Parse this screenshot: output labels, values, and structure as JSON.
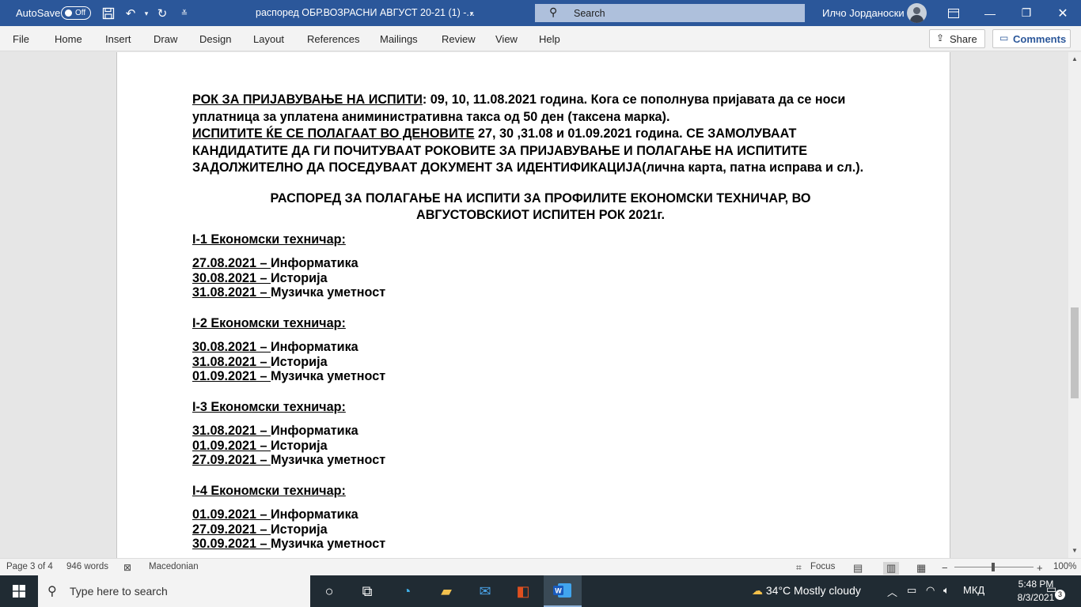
{
  "titlebar": {
    "autosave_label": "AutoSave",
    "autosave_state": "Off",
    "doc_title": "распоред ОБР.ВОЗРАСНИ АВГУСТ  20-21 (1)  -...",
    "search_label": "Search",
    "user_name": "Илчо Јорданоски"
  },
  "ribbon": {
    "tabs": [
      "File",
      "Home",
      "Insert",
      "Draw",
      "Design",
      "Layout",
      "References",
      "Mailings",
      "Review",
      "View",
      "Help"
    ],
    "share_label": "Share",
    "comments_label": "Comments"
  },
  "document": {
    "p1_label": "РОК ЗА ПРИЈАВУВАЊЕ НА ИСПИТИ",
    "p1_text": ":  09, 10, 11.08.2021 година. Кога се пополнува пријавата да се носи уплатница за уплатена аниминистративна такса од 50 ден (таксена марка).",
    "p2_label": "ИСПИТИТЕ ЌЕ СЕ ПОЛАГААТ ВО ДЕНОВИТЕ",
    "p2_text": "  27, 30 ,31.08  и  01.09.2021 година. СЕ ЗАМОЛУВААТ КАНДИДАТИТЕ ДА ГИ ПОЧИТУВААТ РОКОВИТЕ ЗА ПРИЈАВУВАЊЕ И ПОЛАГАЊЕ НА ИСПИТИТЕ ЗАДОЛЖИТЕЛНО ДА  ПОСЕДУВААТ ДОКУМЕНТ ЗА ИДЕНТИФИКАЦИЈА(лична карта, патна исправа и сл.).",
    "heading_line1": "РАСПОРЕД ЗА ПОЛАГАЊЕ НА ИСПИТИ ЗА ПРОФИЛИТЕ ЕКОНОМСКИ ТЕХНИЧАР, ВО",
    "heading_line2": "АВГУСТОВСКИОТ  ИСПИТЕН РОК 2021г.",
    "groups": [
      {
        "title": "I-1 Економски техничар:",
        "rows": [
          {
            "date": "27.08.2021 – ",
            "subject": "Информатика"
          },
          {
            "date": "30.08.2021 – ",
            "subject": "Историја"
          },
          {
            "date": "31.08.2021 – ",
            "subject": "Музичка уметност"
          }
        ]
      },
      {
        "title": "I-2 Економски техничар:",
        "rows": [
          {
            "date": "30.08.2021 – ",
            "subject": "Информатика"
          },
          {
            "date": "31.08.2021 – ",
            "subject": "Историја"
          },
          {
            "date": "01.09.2021 – ",
            "subject": "Музичка уметност"
          }
        ]
      },
      {
        "title": "I-3 Економски техничар:",
        "rows": [
          {
            "date": "31.08.2021 – ",
            "subject": "Информатика"
          },
          {
            "date": "01.09.2021 – ",
            "subject": "Историја"
          },
          {
            "date": "27.09.2021 – ",
            "subject": "Музичка уметност"
          }
        ]
      },
      {
        "title": "I-4 Економски техничар:",
        "rows": [
          {
            "date": "01.09.2021 – ",
            "subject": "Информатика"
          },
          {
            "date": "27.09.2021 – ",
            "subject": "Историја"
          },
          {
            "date": "30.09.2021 – ",
            "subject": "Музичка уметност"
          }
        ]
      }
    ]
  },
  "statusbar": {
    "page": "Page 3 of 4",
    "words": "946 words",
    "language": "Macedonian",
    "focus": "Focus",
    "zoom": "100%"
  },
  "taskbar": {
    "search_placeholder": "Type here to search",
    "weather": "34°C  Mostly cloudy",
    "language": "МКД",
    "time": "5:48 PM",
    "date": "8/3/2021",
    "notifications": "3"
  },
  "colors": {
    "titlebar": "#2b579a",
    "taskbar": "#202b33"
  }
}
